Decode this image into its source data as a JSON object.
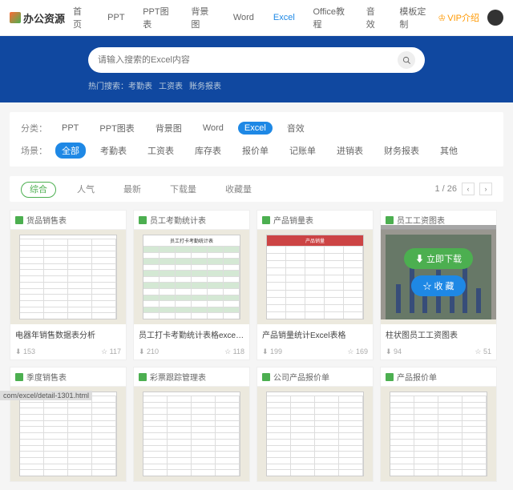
{
  "brand": "办公资源",
  "nav": [
    "首页",
    "PPT",
    "PPT图表",
    "背景图",
    "Word",
    "Excel",
    "Office教程",
    "音效",
    "模板定制"
  ],
  "nav_active": 5,
  "vip": "VIP介绍",
  "search": {
    "placeholder": "请输入搜索的Excel内容"
  },
  "hot": {
    "label": "热门搜索：",
    "items": [
      "考勤表",
      "工资表",
      "账务报表"
    ]
  },
  "cat": {
    "label": "分类：",
    "items": [
      "PPT",
      "PPT图表",
      "背景图",
      "Word",
      "Excel",
      "音效"
    ],
    "active": 4
  },
  "scene": {
    "label": "场景：",
    "items": [
      "全部",
      "考勤表",
      "工资表",
      "库存表",
      "报价单",
      "记账单",
      "进销表",
      "财务报表",
      "其他"
    ],
    "active": 0
  },
  "sort": {
    "items": [
      "综合",
      "人气",
      "最新",
      "下载量",
      "收藏量"
    ],
    "active": 0
  },
  "page": {
    "text": "1 / 26"
  },
  "overlay": {
    "download": "立即下载",
    "favorite": "收 藏"
  },
  "cards": [
    {
      "head": "货品销售表",
      "title": "电器年销售数据表分析",
      "dl": "153",
      "fav": "117"
    },
    {
      "head": "员工考勤统计表",
      "title": "员工打卡考勤统计表格excel模板",
      "dl": "210",
      "fav": "118"
    },
    {
      "head": "产品销量表",
      "title": "产品销量统计Excel表格",
      "dl": "199",
      "fav": "169"
    },
    {
      "head": "员工工资图表",
      "title": "柱状图员工工资图表",
      "dl": "94",
      "fav": "51",
      "hover": true
    },
    {
      "head": "季度销售表"
    },
    {
      "head": "彩票跟踪管理表"
    },
    {
      "head": "公司产品报价单"
    },
    {
      "head": "产品报价单"
    }
  ],
  "status": "com/excel/detail-1301.html"
}
